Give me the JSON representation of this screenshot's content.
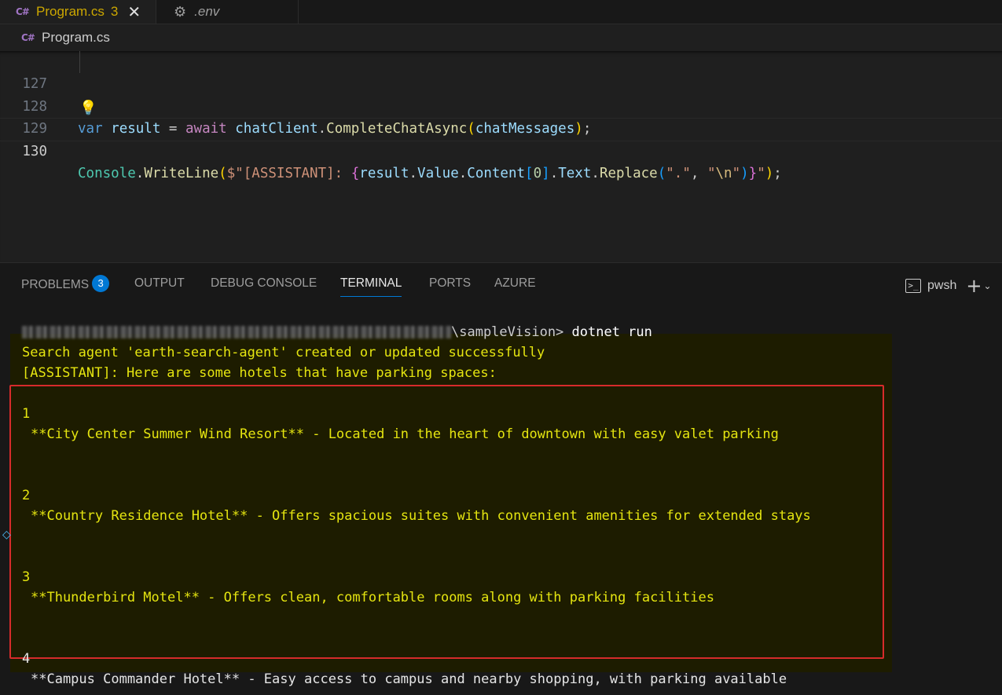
{
  "tabs": [
    {
      "icon": "csharp-icon",
      "label": "Program.cs",
      "badge": "3",
      "close": "✕"
    },
    {
      "icon": "gear-icon",
      "label": ".env"
    }
  ],
  "breadcrumb": {
    "label": "Program.cs"
  },
  "editor": {
    "lines": [
      {
        "number": "127"
      },
      {
        "number": "128"
      },
      {
        "number": "129"
      },
      {
        "number": "130"
      }
    ]
  },
  "panel": {
    "tabs": {
      "problems": "PROBLEMS",
      "problems_count": "3",
      "output": "OUTPUT",
      "debug_console": "DEBUG CONSOLE",
      "terminal": "TERMINAL",
      "ports": "PORTS",
      "azure": "AZURE"
    },
    "shell": "pwsh"
  },
  "terminal": {
    "prompt_suffix": "\\sampleVision> ",
    "command": "dotnet run",
    "lines": [
      "Search agent 'earth-search-agent' created or updated successfully",
      "[ASSISTANT]: Here are some hotels that have parking spaces:",
      "1",
      "**City Center Summer Wind Resort** - Located in the heart of downtown with easy valet parking",
      "2",
      "**Country Residence Hotel** - Offers spacious suites with convenient amenities for extended stays",
      "3",
      "**Thunderbird Motel** - Offers clean, comfortable rooms along with parking facilities",
      "4",
      "**Campus Commander Hotel** - Easy access to campus and nearby shopping, with parking available"
    ]
  },
  "colors": {
    "accent": "#0078d4",
    "terminal_yellow": "#e5e510",
    "highlight_border": "#d62b2b",
    "modified_tab": "#cca700"
  }
}
